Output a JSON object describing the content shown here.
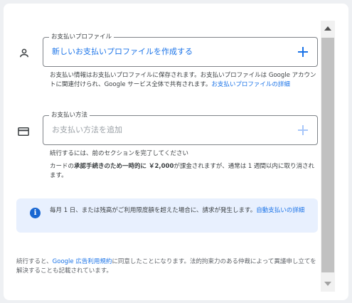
{
  "profile": {
    "legend": "お支払いプロファイル",
    "value": "新しいお支払いプロファイルを作成する",
    "help_text": "お支払い情報はお支払いプロファイルに保存されます。お支払いプロファイルは Google アカウントに関連付けられ、Google サービス全体で共有されます。",
    "help_link": "お支払いプロファイルの詳細",
    "icon": "person-icon",
    "accent": "#1a73e8"
  },
  "payment": {
    "legend": "お支払い方法",
    "placeholder": "お支払い方法を追加",
    "icon": "credit-card-icon",
    "note_line": "続行するには、前のセクションを完了してください",
    "card_note_prefix": "カードの",
    "card_note_bold": "承認手続きのため一時的に ￥2,000",
    "card_note_suffix": "が課金されますが、通常は 1 週間以内に取り消されます。",
    "plus_color": "#a8c7fa"
  },
  "info": {
    "text": "毎月 1 日、または残高がご利用限度額を超えた場合に、請求が発生します。",
    "link": "自動支払いの詳細",
    "background": "#e8f0fe"
  },
  "footer": {
    "prefix": "続行すると、",
    "link": "Google 広告利用規約",
    "suffix": "に同意したことになります。法的拘束力のある仲裁によって異議申し立てを解決することも記載されています。"
  }
}
